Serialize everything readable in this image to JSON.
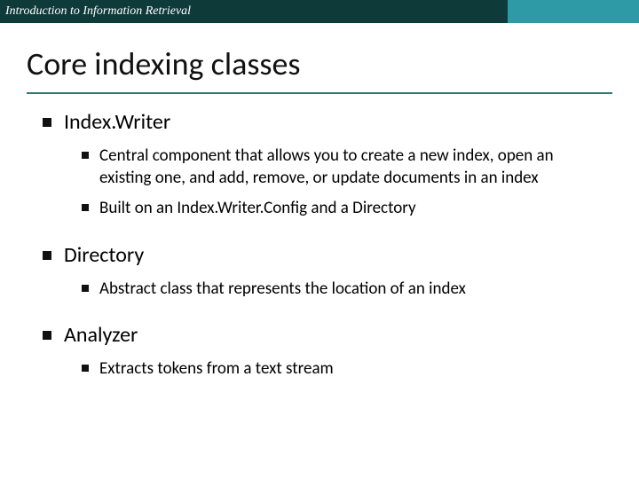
{
  "header": {
    "course": "Introduction to Information Retrieval"
  },
  "title": "Core indexing classes",
  "bullets": [
    {
      "label": "Index.Writer",
      "sub": [
        "Central component that allows you to create a new index, open an existing one, and add, remove, or update documents in an index",
        "Built on an Index.Writer.Config and a Directory"
      ]
    },
    {
      "label": "Directory",
      "sub": [
        "Abstract class that represents the location of an index"
      ]
    },
    {
      "label": "Analyzer",
      "sub": [
        "Extracts tokens from a text stream"
      ]
    }
  ]
}
